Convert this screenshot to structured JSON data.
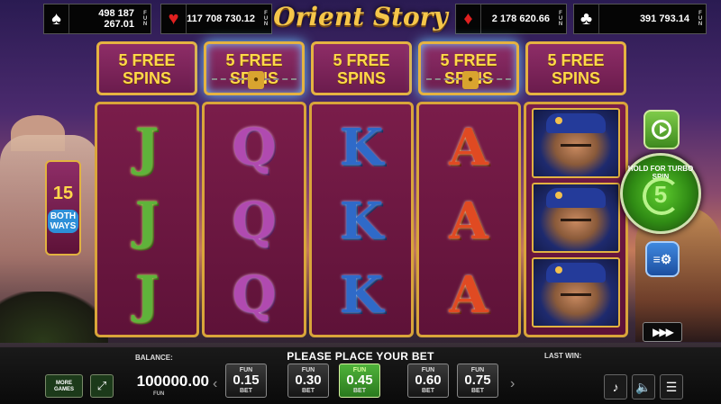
{
  "title": "Orient Story",
  "jackpots": [
    {
      "suit": "spade-icon",
      "glyph": "♠",
      "value": "498 187 267.01",
      "fun": "FUN"
    },
    {
      "suit": "heart-icon",
      "glyph": "♥",
      "value": "117 708 730.12",
      "fun": "FUN"
    },
    {
      "suit": "diamond-icon",
      "glyph": "♦",
      "value": "2 178 620.66",
      "fun": "FUN"
    },
    {
      "suit": "club-icon",
      "glyph": "♣",
      "value": "391 793.14",
      "fun": "FUN"
    }
  ],
  "free_spins": [
    {
      "line1": "5 FREE",
      "line2": "SPINS",
      "locked": false
    },
    {
      "line1": "5 FREE",
      "line2": "SPINS",
      "locked": true
    },
    {
      "line1": "5 FREE",
      "line2": "SPINS",
      "locked": false
    },
    {
      "line1": "5 FREE",
      "line2": "SPINS",
      "locked": true
    },
    {
      "line1": "5 FREE",
      "line2": "SPINS",
      "locked": false
    }
  ],
  "reels": [
    {
      "symbols": [
        "J",
        "J",
        "J"
      ]
    },
    {
      "symbols": [
        "Q",
        "Q",
        "Q"
      ]
    },
    {
      "symbols": [
        "K",
        "K",
        "K"
      ]
    },
    {
      "symbols": [
        "A",
        "A",
        "A"
      ]
    },
    {
      "symbols": [
        "portrait",
        "portrait",
        "portrait"
      ]
    }
  ],
  "ways_badge": {
    "number": "15",
    "line1": "BOTH",
    "line2": "WAYS"
  },
  "spin": {
    "hold_text": "HOLD FOR TURBO SPIN",
    "number": "5"
  },
  "turbo": {
    "label": "▶▶▶"
  },
  "message": "PLEASE PLACE YOUR BET",
  "balance": {
    "label": "BALANCE:",
    "value": "100000.00",
    "unit": "FUN"
  },
  "last_win": {
    "label": "LAST WIN:"
  },
  "more_games": {
    "line1": "MORE",
    "line2": "GAMES"
  },
  "bets": [
    {
      "fun": "FUN",
      "value": "0.15",
      "bet": "BET",
      "active": false
    },
    {
      "fun": "FUN",
      "value": "0.30",
      "bet": "BET",
      "active": false
    },
    {
      "fun": "FUN",
      "value": "0.45",
      "bet": "BET",
      "active": true
    },
    {
      "fun": "FUN",
      "value": "0.60",
      "bet": "BET",
      "active": false
    },
    {
      "fun": "FUN",
      "value": "0.75",
      "bet": "BET",
      "active": false
    }
  ],
  "colors": {
    "gold": "#e5b341",
    "reel_bg": "#7a1d4a",
    "spin_green": "#2f8a14",
    "settings_blue": "#3f88de"
  }
}
